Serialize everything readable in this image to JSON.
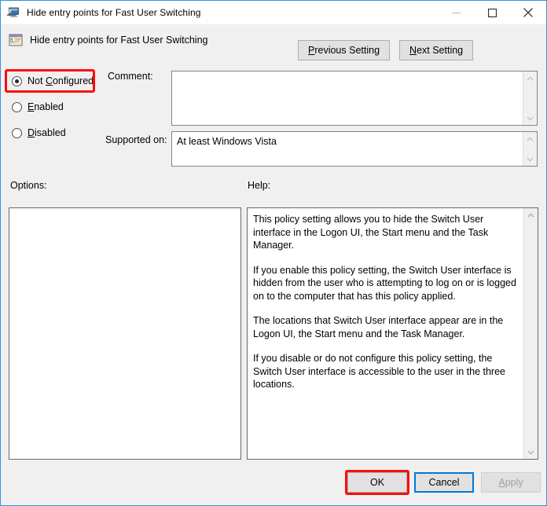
{
  "window": {
    "title": "Hide entry points for Fast User Switching",
    "title_icon": "user-monitor-icon",
    "controls": {
      "minimize": "minimize-icon",
      "maximize": "maximize-icon",
      "close": "close-icon"
    },
    "active_border_color": "#3a8edc"
  },
  "header": {
    "policy_name": "Hide entry points for Fast User Switching",
    "policy_icon": "policy-window-icon",
    "previous_setting": "Previous Setting",
    "previous_setting_accel": "P",
    "next_setting": "Next Setting",
    "next_setting_accel": "N"
  },
  "state_options": {
    "selected": "Not Configured",
    "items": [
      {
        "label": "Not Configured",
        "accel": "C",
        "pre": "Not ",
        "post": "onfigured",
        "checked": true
      },
      {
        "label": "Enabled",
        "accel": "E",
        "pre": "",
        "post": "nabled",
        "checked": false
      },
      {
        "label": "Disabled",
        "accel": "D",
        "pre": "",
        "post": "isabled",
        "checked": false
      }
    ]
  },
  "comment": {
    "label": "Comment:",
    "value": ""
  },
  "supported_on": {
    "label": "Supported on:",
    "value": "At least Windows Vista"
  },
  "options": {
    "label": "Options:",
    "content": ""
  },
  "help": {
    "label": "Help:",
    "paragraphs": [
      "This policy setting allows you to hide the Switch User interface in the Logon UI, the Start menu and the Task Manager.",
      "If you enable this policy setting, the Switch User interface is hidden from the user who is attempting to log on or is logged on to the computer that has this policy applied.",
      "The locations that Switch User interface appear are in the Logon UI, the Start menu and the Task Manager.",
      "If you disable or do not configure this policy setting, the Switch User interface is accessible to the user in the three locations."
    ]
  },
  "footer": {
    "ok": "OK",
    "cancel": "Cancel",
    "apply": "Apply",
    "apply_accel": "A",
    "apply_disabled": true,
    "focused_button": "Cancel"
  },
  "annotations": {
    "highlight_color": "#fb0d0d",
    "focus_color": "#0078d7",
    "highlighted": [
      "Not Configured",
      "OK"
    ]
  }
}
